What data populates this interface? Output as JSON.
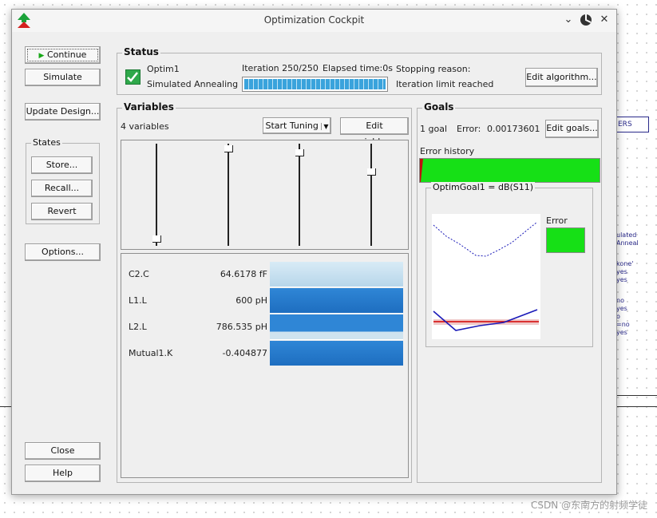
{
  "window": {
    "title": "Optimization Cockpit"
  },
  "left": {
    "continue_label": "Continue",
    "simulate_label": "Simulate",
    "update_design_label": "Update Design...",
    "states_title": "States",
    "store_label": "Store...",
    "recall_label": "Recall...",
    "revert_label": "Revert",
    "options_label": "Options...",
    "close_label": "Close",
    "help_label": "Help"
  },
  "status": {
    "title": "Status",
    "optim_name": "Optim1",
    "algorithm": "Simulated Annealing",
    "iteration": "Iteration 250/250",
    "elapsed": "Elapsed time:0s",
    "progress": 1.0,
    "stopping_label": "Stopping reason:",
    "stopping_reason": "Iteration limit reached",
    "edit_algorithm_label": "Edit algorithm..."
  },
  "variables": {
    "title": "Variables",
    "count": "4 variables",
    "start_tuning_label": "Start Tuning",
    "edit_variables_label": "Edit variables...",
    "sliders": [
      0.97,
      0.02,
      0.06,
      0.26
    ],
    "items": [
      {
        "name": "C2.C",
        "value": "64.6178 fF"
      },
      {
        "name": "L1.L",
        "value": "600 pH"
      },
      {
        "name": "L2.L",
        "value": "786.535 pH"
      },
      {
        "name": "Mutual1.K",
        "value": "-0.404877"
      }
    ]
  },
  "goals": {
    "title": "Goals",
    "count": "1 goal",
    "error_label": "Error:",
    "error_value": "0.00173601",
    "edit_goals_label": "Edit goals...",
    "error_history_label": "Error history",
    "plot_title": "OptimGoal1 = dB(S11)",
    "plot_legend": "Error",
    "colors": {
      "error_ok": "#16e016",
      "trace": "#1a1ab8",
      "limit": "#d40000"
    }
  },
  "background": {
    "box_text": "ERS",
    "side_text": [
      "ulated Anneal",
      "kone'",
      "yes",
      "yes",
      "no",
      "yes",
      "o",
      "=no",
      "yes"
    ]
  },
  "watermark": "CSDN @东南方的射频学徒"
}
